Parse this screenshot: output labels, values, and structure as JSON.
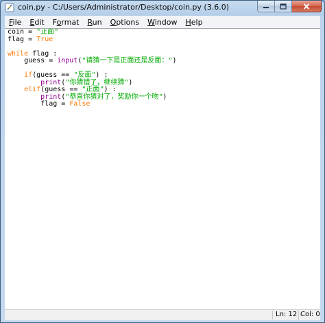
{
  "window": {
    "title": "coin.py - C:/Users/Administrator/Desktop/coin.py (3.6.0)",
    "icon": "python-feather-icon",
    "buttons": {
      "minimize": "minimize-icon",
      "maximize": "maximize-icon",
      "close": "close-icon"
    }
  },
  "menu": [
    {
      "underline": "F",
      "rest": "ile"
    },
    {
      "underline": "E",
      "rest": "dit"
    },
    {
      "pre": "F",
      "underline": "o",
      "rest": "rmat"
    },
    {
      "underline": "R",
      "rest": "un"
    },
    {
      "underline": "O",
      "rest": "ptions"
    },
    {
      "underline": "W",
      "rest": "indow"
    },
    {
      "underline": "H",
      "rest": "elp"
    }
  ],
  "code_lines": [
    [
      [
        "t",
        "coin = "
      ],
      [
        "s",
        "\"正面\""
      ]
    ],
    [
      [
        "t",
        "flag = "
      ],
      [
        "k",
        "True"
      ]
    ],
    [],
    [
      [
        "k",
        "while"
      ],
      [
        "t",
        " flag :"
      ]
    ],
    [
      [
        "t",
        "    guess = "
      ],
      [
        "b",
        "input"
      ],
      [
        "t",
        "("
      ],
      [
        "s",
        "\"请猜一下是正面还是反面：\""
      ],
      [
        "t",
        ")"
      ]
    ],
    [],
    [
      [
        "t",
        "    "
      ],
      [
        "k",
        "if"
      ],
      [
        "t",
        "(guess == "
      ],
      [
        "s",
        "\"反面\""
      ],
      [
        "t",
        ") :"
      ]
    ],
    [
      [
        "t",
        "        "
      ],
      [
        "b",
        "print"
      ],
      [
        "t",
        "("
      ],
      [
        "s",
        "\"你猜错了，继续猜\""
      ],
      [
        "t",
        ")"
      ]
    ],
    [
      [
        "t",
        "    "
      ],
      [
        "k",
        "elif"
      ],
      [
        "t",
        "(guess == "
      ],
      [
        "s",
        "\"正面\""
      ],
      [
        "t",
        ") :"
      ]
    ],
    [
      [
        "t",
        "        "
      ],
      [
        "b",
        "print"
      ],
      [
        "t",
        "("
      ],
      [
        "s",
        "\"恭喜你猜对了，奖励你一个吻\""
      ],
      [
        "t",
        ")"
      ]
    ],
    [
      [
        "t",
        "        flag = "
      ],
      [
        "k",
        "False"
      ]
    ]
  ],
  "status": {
    "line": "Ln: 12",
    "col": "Col: 0"
  },
  "colors": {
    "keyword": "#ff7700",
    "string": "#00aa00",
    "builtin": "#900090"
  }
}
